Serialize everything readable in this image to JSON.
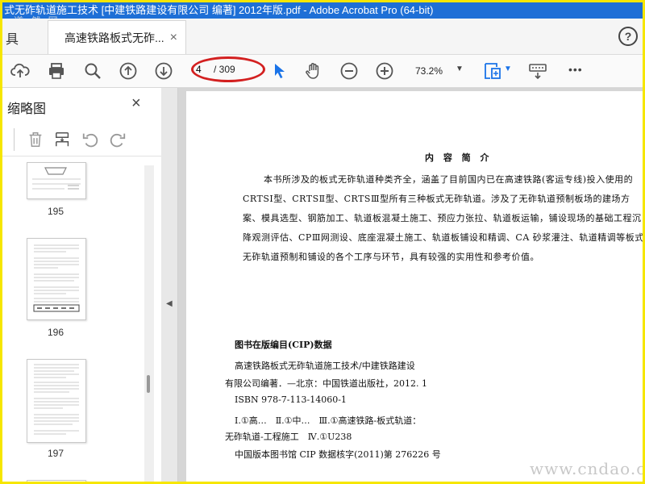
{
  "window": {
    "title": "式无砟轨道施工技术 [中建铁路建设有限公司 编著] 2012年版.pdf - Adobe Acrobat Pro (64-bit)"
  },
  "tabs": {
    "tools_label": "具",
    "doc_label": "高速铁路板式无砟...",
    "close": "×",
    "help": "?"
  },
  "toolbar": {
    "page_current": "4",
    "page_total": "/ 309",
    "zoom": "73.2%",
    "more": "•••",
    "icons": [
      "upload-icon",
      "print-icon",
      "search-icon",
      "page-up-icon",
      "page-down-icon",
      "select-arrow-icon",
      "hand-icon",
      "zoom-out-icon",
      "zoom-in-icon",
      "fit-page-icon",
      "keyboard-icon",
      "more-icon"
    ],
    "accent": "#1a73e8",
    "oval_color": "#d32020"
  },
  "sidebar": {
    "title": "缩略图",
    "close": "×",
    "thumbnails": [
      {
        "label": "195"
      },
      {
        "label": "196"
      },
      {
        "label": "197"
      }
    ]
  },
  "document": {
    "heading": "内 容 简 介",
    "paragraph": "本书所涉及的板式无砟轨道种类齐全，涵盖了目前国内已在高速铁路(客运专线)投入使用的CRTSⅠ型、CRTSⅡ型、CRTSⅢ型所有三种板式无砟轨道。涉及了无砟轨道预制板场的建场方案、模具选型、钢筋加工、轨道板混凝土施工、预应力张拉、轨道板运输，铺设现场的基础工程沉降观测评估、CPⅢ网测设、底座混凝土施工、轨道板铺设和精调、CA 砂浆灌注、轨道精调等板式无砟轨道预制和铺设的各个工序与环节，具有较强的实用性和参考价值。",
    "cip_title": "图书在版编目(CIP)数据",
    "cip_lines": [
      "高速铁路板式无砟轨道施工技术/中建铁路建设",
      "有限公司编著．—北京：中国铁道出版社，2012. 1",
      "ISBN 978-7-113-14060-1",
      "Ⅰ.①高…　Ⅱ.①中…　Ⅲ.①高速铁路-板式轨道：",
      "无砟轨道-工程施工　Ⅳ.①U238",
      "中国版本图书馆 CIP 数据核字(2011)第 276226 号"
    ]
  },
  "watermark": {
    "bottom": "www.cndao.com",
    "top": "道 然 网"
  }
}
